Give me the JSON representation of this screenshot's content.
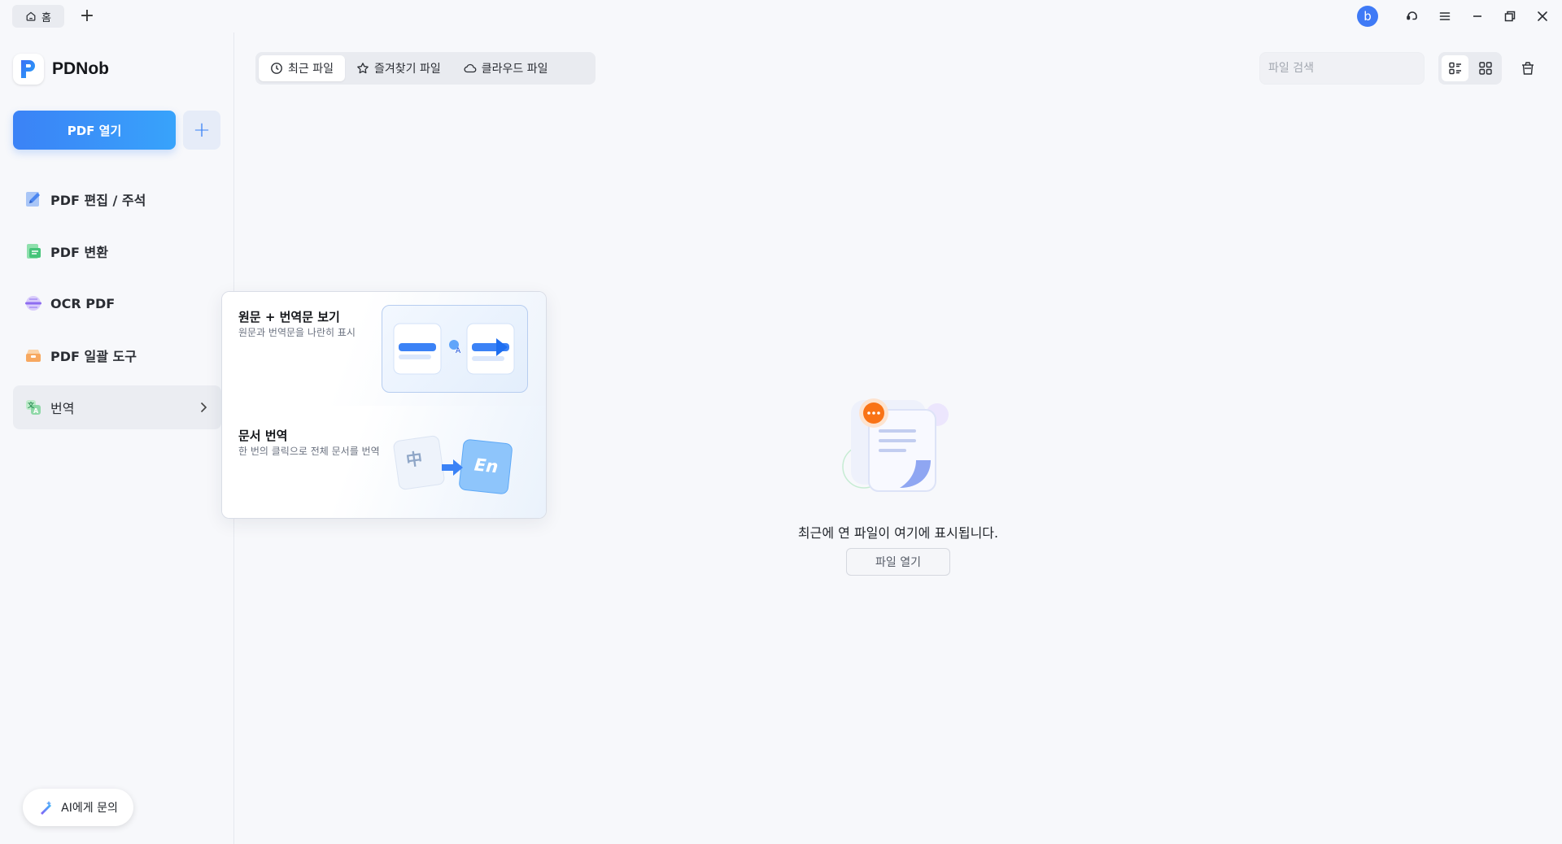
{
  "titlebar": {
    "home_tab_label": "홈",
    "new_tab": "+",
    "avatar_letter": "b"
  },
  "sidebar": {
    "brand": "PDNob",
    "open_pdf_label": "PDF 열기",
    "add_label": "+",
    "items": [
      {
        "label": "PDF 편집 / 주석",
        "icon": "edit-icon"
      },
      {
        "label": "PDF 변환",
        "icon": "convert-icon"
      },
      {
        "label": "OCR PDF",
        "icon": "ocr-icon"
      },
      {
        "label": "PDF 일괄 도구",
        "icon": "batch-tools-icon"
      },
      {
        "label": "번역",
        "icon": "translate-icon",
        "active": true
      }
    ],
    "ai_label": "AI에게 문의"
  },
  "flyout": {
    "cards": [
      {
        "title": "원문 + 번역문 보기",
        "desc": "원문과 번역문을 나란히 표시"
      },
      {
        "title": "문서 번역",
        "desc": "한 번의 클릭으로 전체 문서를 번역"
      }
    ],
    "badge_zh": "中",
    "badge_en": "En"
  },
  "main": {
    "tabs": [
      {
        "label": "최근 파일",
        "icon": "clock-icon",
        "active": true
      },
      {
        "label": "즐겨찾기 파일",
        "icon": "star-icon"
      },
      {
        "label": "클라우드 파일",
        "icon": "cloud-icon"
      }
    ],
    "search_placeholder": "파일 검색",
    "view_mode": "list",
    "empty_text": "최근에 연 파일이 여기에 표시됩니다.",
    "empty_button": "파일 열기"
  },
  "colors": {
    "accent": "#3b82f6",
    "avatar": "#3f7af6",
    "badge_orange": "#f97316"
  }
}
